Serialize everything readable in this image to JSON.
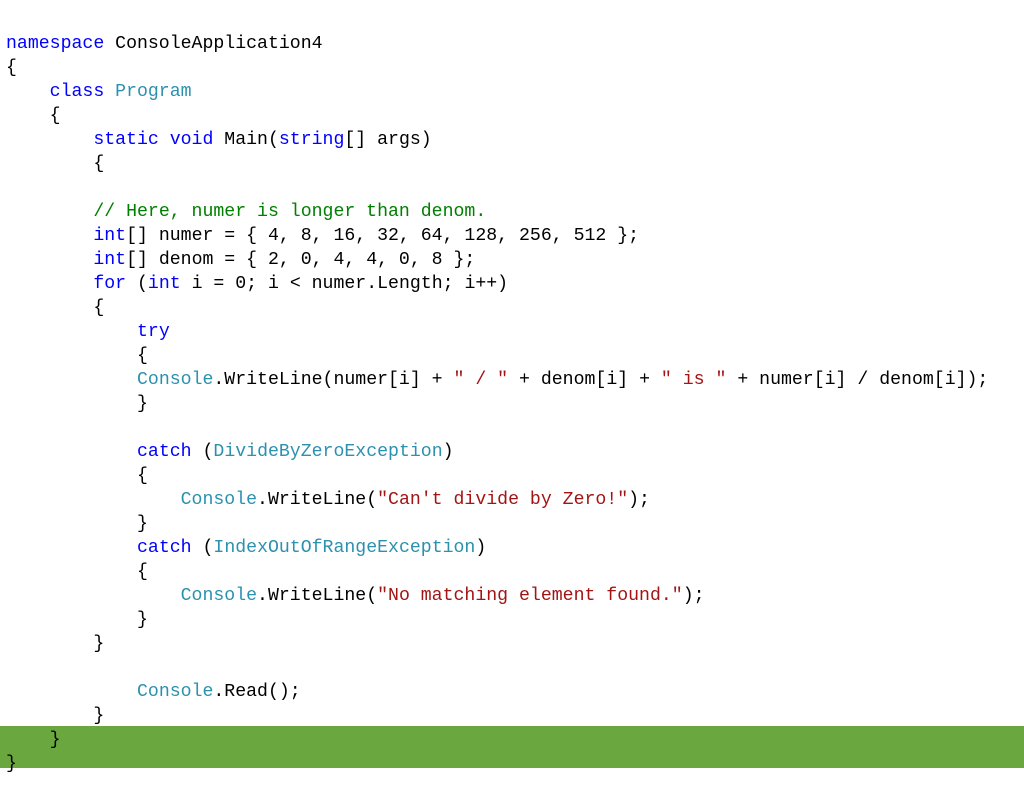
{
  "code": {
    "l1": {
      "a": "namespace",
      "b": " ConsoleApplication4"
    },
    "l2": "{",
    "l3": {
      "a": "    class",
      "b": " Program"
    },
    "l4": "    {",
    "l5": {
      "a": "        static",
      "b": " void",
      "c": " Main(",
      "d": "string",
      "e": "[] args)"
    },
    "l6": "        {",
    "l7": "",
    "l8": {
      "a": "        ",
      "b": "// Here, numer is longer than denom."
    },
    "l9": {
      "a": "        ",
      "b": "int",
      "c": "[] numer = { 4, 8, 16, 32, 64, 128, 256, 512 };"
    },
    "l10": {
      "a": "        ",
      "b": "int",
      "c": "[] denom = { 2, 0, 4, 4, 0, 8 };"
    },
    "l11": {
      "a": "        ",
      "b": "for",
      "c": " (",
      "d": "int",
      "e": " i = 0; i < numer.Length; i++)"
    },
    "l12": "        {",
    "l13": {
      "a": "            ",
      "b": "try"
    },
    "l14": "            {",
    "l15": {
      "a": "            ",
      "b": "Console",
      "c": ".WriteLine(numer[i] + ",
      "d": "\" / \"",
      "e": " + denom[i] + ",
      "f": "\" is \"",
      "g": " + numer[i] / denom[i]);"
    },
    "l16": "            }",
    "l17": "",
    "l18": {
      "a": "            ",
      "b": "catch",
      "c": " (",
      "d": "DivideByZeroException",
      "e": ")"
    },
    "l19": "            {",
    "l20": {
      "a": "                ",
      "b": "Console",
      "c": ".WriteLine(",
      "d": "\"Can't divide by Zero!\"",
      "e": ");"
    },
    "l21": "            }",
    "l22": {
      "a": "            ",
      "b": "catch",
      "c": " (",
      "d": "IndexOutOfRangeException",
      "e": ")"
    },
    "l23": "            {",
    "l24": {
      "a": "                ",
      "b": "Console",
      "c": ".WriteLine(",
      "d": "\"No matching element found.\"",
      "e": ");"
    },
    "l25": "            }",
    "l26": "        }",
    "l27": "",
    "l28": {
      "a": "            ",
      "b": "Console",
      "c": ".Read();"
    },
    "l29": "        }",
    "l30": "    }",
    "l31": "}"
  }
}
